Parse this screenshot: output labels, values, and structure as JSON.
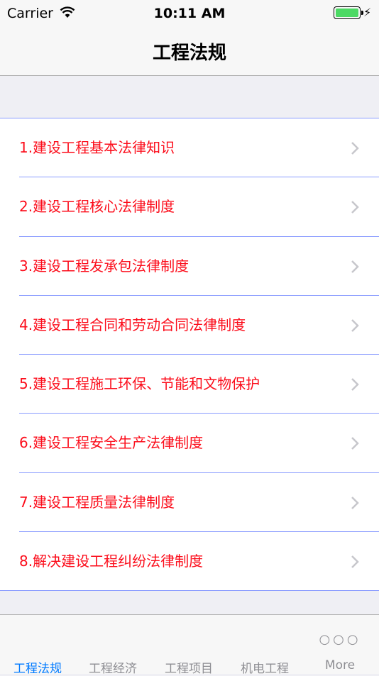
{
  "status_bar": {
    "carrier": "Carrier",
    "time": "10:11 AM"
  },
  "nav": {
    "title": "工程法规"
  },
  "list": {
    "items": [
      {
        "label": "1.建设工程基本法律知识"
      },
      {
        "label": "2.建设工程核心法律制度"
      },
      {
        "label": "3.建设工程发承包法律制度"
      },
      {
        "label": "4.建设工程合同和劳动合同法律制度"
      },
      {
        "label": "5.建设工程施工环保、节能和文物保护"
      },
      {
        "label": "6.建设工程安全生产法律制度"
      },
      {
        "label": "7.建设工程质量法律制度"
      },
      {
        "label": "8.解决建设工程纠纷法律制度"
      }
    ]
  },
  "tabs": [
    {
      "label": "工程法规",
      "active": true
    },
    {
      "label": "工程经济",
      "active": false
    },
    {
      "label": "工程项目",
      "active": false
    },
    {
      "label": "机电工程",
      "active": false
    },
    {
      "label": "More",
      "active": false,
      "icon": "more-dots-icon"
    }
  ],
  "colors": {
    "item_text": "#fc0d1b",
    "separator": "#8a9cff",
    "tab_active": "#007aff",
    "tab_inactive": "#8e8e93",
    "battery": "#4cd964"
  }
}
